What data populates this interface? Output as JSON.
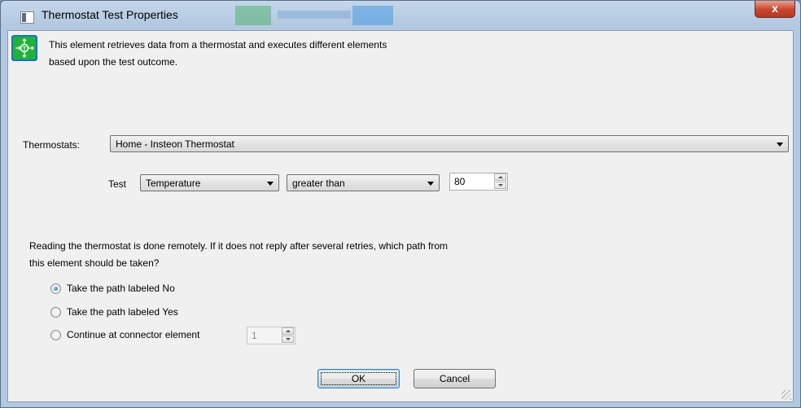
{
  "window": {
    "title": "Thermostat Test Properties",
    "close_glyph": "x"
  },
  "element": {
    "icon": "thermostat-element-icon",
    "description_line1": "This element retrieves data from a thermostat and executes different elements",
    "description_line2": "based upon the test outcome."
  },
  "thermostats": {
    "label": "Thermostats:",
    "selected": "Home - Insteon Thermostat"
  },
  "test": {
    "label": "Test",
    "property_selected": "Temperature",
    "comparison_selected": "greater than",
    "value": "80"
  },
  "timeout": {
    "text_line1": "Reading the thermostat is done remotely.  If it does not reply after several retries, which path from",
    "text_line2": "this element should be taken?",
    "options": [
      {
        "label": "Take the path labeled No",
        "checked": true
      },
      {
        "label": "Take the path labeled Yes",
        "checked": false
      },
      {
        "label": "Continue at connector element",
        "checked": false
      }
    ],
    "connector_value": "1"
  },
  "buttons": {
    "ok": "OK",
    "cancel": "Cancel"
  },
  "colors": {
    "frame": "#b3c9e1",
    "client": "#f0f0f0",
    "close_button": "#c7442c",
    "icon_green": "#21b23c",
    "icon_border": "#1a6fd0"
  }
}
